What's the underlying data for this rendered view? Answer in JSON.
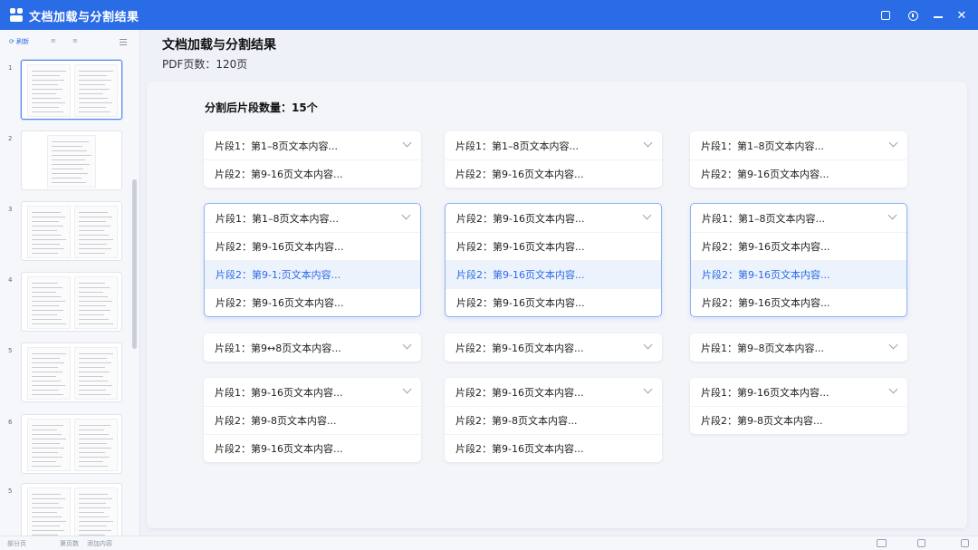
{
  "app": {
    "title": "文档加载与分割结果"
  },
  "sidebar": {
    "toolbar": {
      "refresh": "刷新",
      "t2": "≡",
      "t3": "≡"
    },
    "pages": [
      "1",
      "2",
      "3",
      "4",
      "5",
      "6",
      "5"
    ]
  },
  "header": {
    "title": "文档加载与分割结果",
    "pdf_pages": "PDF页数：120页"
  },
  "main": {
    "count_label": "分割后片段数量：15个",
    "cards": [
      {
        "open": false,
        "rows": [
          "片段1：第1–8页文本内容...",
          "片段2：第9-16页文本内容..."
        ]
      },
      {
        "open": false,
        "rows": [
          "片段1：第1–8页文本内容...",
          "片段2：第9-16页文本内容..."
        ]
      },
      {
        "open": false,
        "rows": [
          "片段1：第1–8页文本内容...",
          "片段2：第9-16页文本内容..."
        ]
      },
      {
        "open": true,
        "rows": [
          "片段1：第1–8页文本内容...",
          "片段2：第9-16页文本内容...",
          "片段2：第9-1;页文本内容...",
          "片段2：第9-16页文本内容..."
        ]
      },
      {
        "open": true,
        "rows": [
          "片段2：第9-16页文本内容...",
          "片段2：第9-16页文本内容...",
          "片段2：第9-16页文本内容...",
          "片段2：第9-16页文本内容..."
        ]
      },
      {
        "open": true,
        "rows": [
          "片段1：第1–8页文本内容...",
          "片段2：第9-16页文本内容...",
          "片段2：第9-16页文本内容...",
          "片段2：第9-16页文本内容..."
        ]
      },
      {
        "open": false,
        "rows": [
          "片段1：第9↔8页文本内容..."
        ]
      },
      {
        "open": false,
        "rows": [
          "片段2：第9-16页文本内容..."
        ]
      },
      {
        "open": false,
        "rows": [
          "片段1：第9–8页文本内容..."
        ]
      },
      {
        "open": false,
        "rows": [
          "片段1：第9-16页文本内容...",
          "片段2：第9-8页文本内容...",
          "片段2：第9-16页文本内容..."
        ]
      },
      {
        "open": false,
        "rows": [
          "片段2：第9-16页文本内容...",
          "片段2：第9-8页文本内容...",
          "片段2：第9-16页文本内容..."
        ]
      },
      {
        "open": false,
        "rows": [
          "片段1：第9-16页文本内容...",
          "片段2：第9-8页文本内容..."
        ]
      }
    ]
  },
  "statusbar": {
    "left": "部分页",
    "mid1": "第页数",
    "mid2": "添加内容"
  },
  "colors": {
    "accent": "#2a6be6",
    "highlight_bg": "#edf3fd",
    "open_border": "#8fb1f2"
  }
}
